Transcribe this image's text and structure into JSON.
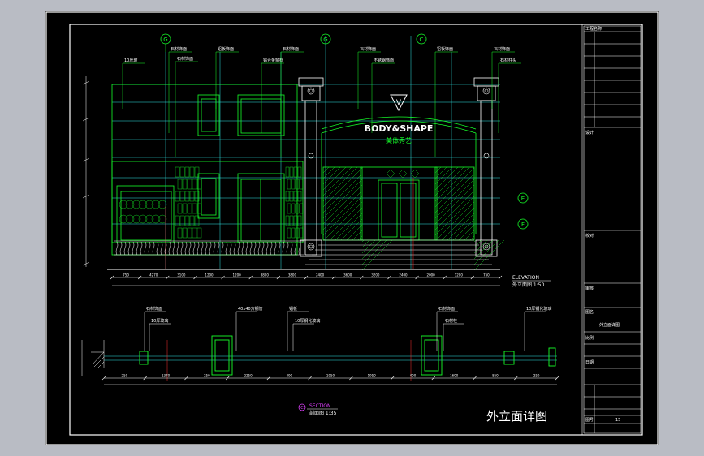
{
  "drawing": {
    "title_cn": "外立面详图",
    "elevation_label": "ELEVATION",
    "elevation_sub": "外立面图 1:50",
    "section_label": "SECTION",
    "section_sub": "剖面图 1:35",
    "section_mark": "C",
    "grid_marks": [
      "G",
      "G",
      "C"
    ],
    "side_marks": [
      "E",
      "F"
    ],
    "brand_text": "BODY&SHAPE",
    "brand_sub": "美体秀艺",
    "logo_letter": "V"
  },
  "annotations_top": [
    "10厚玻",
    "石材饰面",
    "石材饰面",
    "铝板饰面",
    "铝合金窗框",
    "石材饰面",
    "石材饰面",
    "不锈钢饰面",
    "铝板饰面",
    "石材饰面",
    "石材柱头"
  ],
  "annotations_section": [
    "石材饰面",
    "10厚玻璃",
    "40x40方钢管",
    "铝板",
    "10厚钢化玻璃",
    "石材饰面",
    "石材柱",
    "10厚钢化玻璃"
  ],
  "dims_elevation": [
    "750",
    "4270",
    "3100",
    "1200",
    "1200",
    "3800",
    "3800",
    "2400",
    "3600",
    "3200",
    "2400",
    "2000",
    "1200",
    "750"
  ],
  "dims_section": [
    "250",
    "1370",
    "250",
    "2250",
    "400",
    "1950",
    "1950",
    "400",
    "1600",
    "850",
    "250"
  ],
  "title_block": [
    "工程名称",
    "设计",
    "校对",
    "审核",
    "图名",
    "外立面详图",
    "比例",
    "日期",
    "图号",
    "15"
  ],
  "colors": {
    "line_green": "#16ff2a",
    "line_cyan": "#30e8e8",
    "line_white": "#ffffff",
    "line_red": "#ff3030",
    "mark_magenta": "#e040ff",
    "background": "#000000",
    "app_bg": "#b9bcc4"
  }
}
